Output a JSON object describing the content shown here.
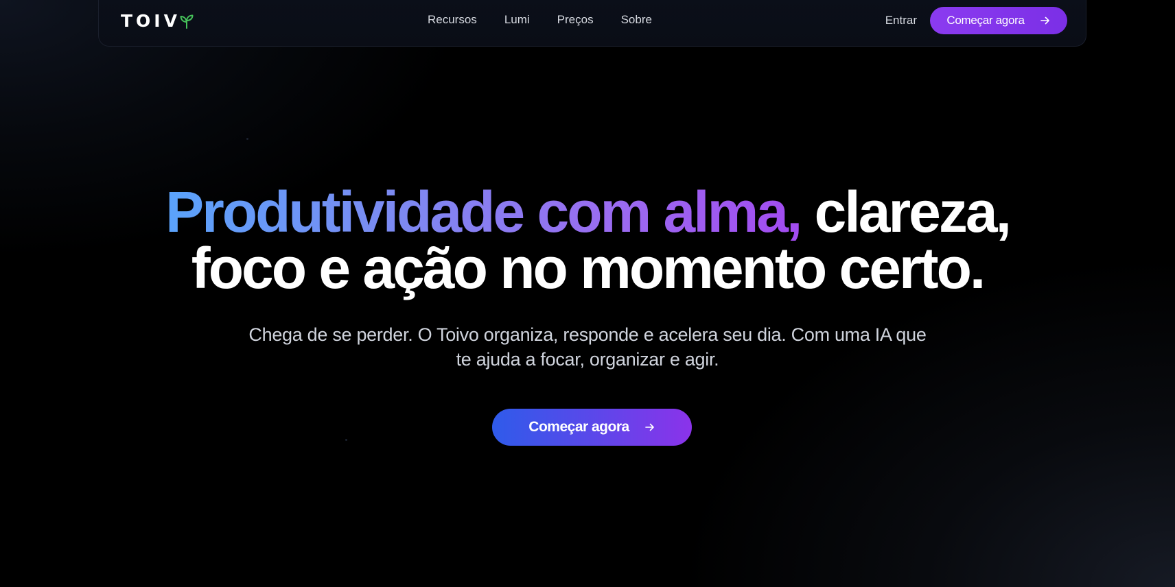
{
  "brand": {
    "name": "TOIV",
    "icon": "sprout-icon",
    "icon_color": "#46c35a"
  },
  "nav": {
    "links": [
      {
        "label": "Recursos"
      },
      {
        "label": "Lumi"
      },
      {
        "label": "Preços"
      },
      {
        "label": "Sobre"
      }
    ],
    "login_label": "Entrar",
    "cta_label": "Começar agora",
    "cta_icon": "arrow-right-icon"
  },
  "hero": {
    "title_gradient": "Produtividade com alma,",
    "title_rest": " clareza,",
    "title_line2": "foco e ação no momento certo.",
    "subtitle": "Chega de se perder. O Toivo organiza, responde e acelera seu dia. Com uma IA que te ajuda a focar, organizar e agir.",
    "cta_label": "Começar agora",
    "cta_icon": "arrow-right-icon"
  },
  "colors": {
    "accent_purple": "#8b3bf0",
    "gradient_blue": "#5aa3fb",
    "background": "#000000"
  }
}
